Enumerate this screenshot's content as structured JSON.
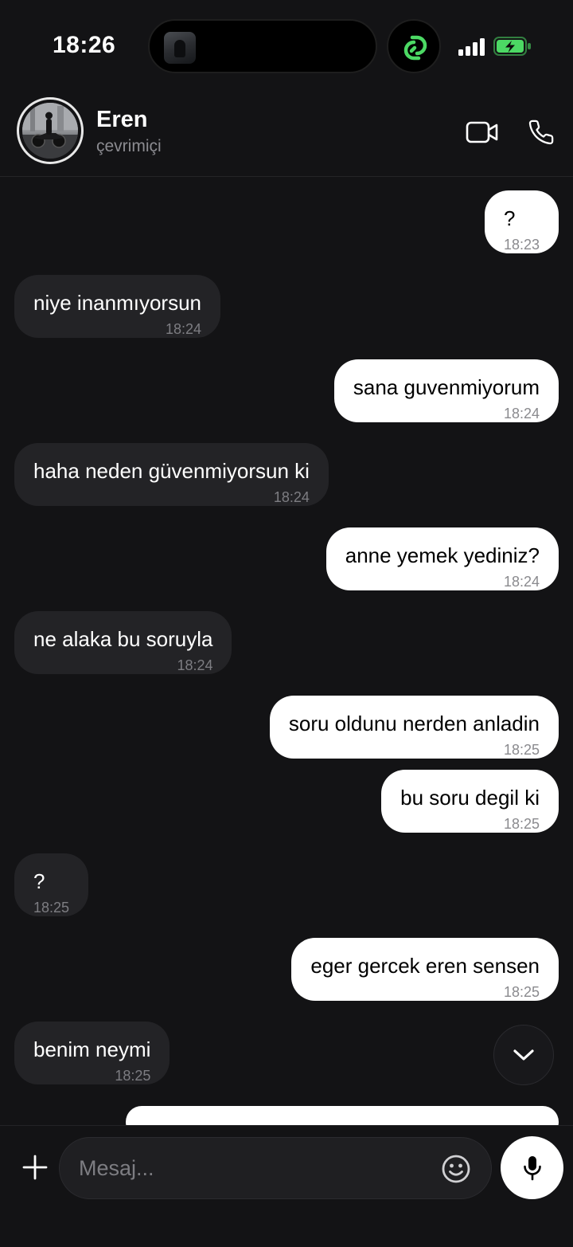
{
  "status_bar": {
    "time": "18:26",
    "icons": [
      "album-art-icon",
      "link-app-icon",
      "signal-icon",
      "battery-charging-icon"
    ],
    "accent_color": "#4cd964"
  },
  "header": {
    "contact_name": "Eren",
    "contact_status": "çevrimiçi",
    "icons": [
      "avatar",
      "video-call-icon",
      "phone-icon"
    ]
  },
  "messages": [
    {
      "direction": "out",
      "text": "?",
      "time": "18:23"
    },
    {
      "direction": "in",
      "text": "niye inanmıyorsun",
      "time": "18:24"
    },
    {
      "direction": "out",
      "text": "sana guvenmiyorum",
      "time": "18:24"
    },
    {
      "direction": "in",
      "text": "haha neden güvenmiyorsun ki",
      "time": "18:24"
    },
    {
      "direction": "out",
      "text": "anne yemek yediniz?",
      "time": "18:24"
    },
    {
      "direction": "in",
      "text": "ne alaka bu soruyla",
      "time": "18:24"
    },
    {
      "direction": "out",
      "text": "soru oldunu nerden anladin",
      "time": "18:25"
    },
    {
      "direction": "out",
      "text": "bu soru degil ki",
      "time": "18:25"
    },
    {
      "direction": "in",
      "text": "?",
      "time": "18:25"
    },
    {
      "direction": "out",
      "text": "eger gercek eren sensen",
      "time": "18:25"
    },
    {
      "direction": "in",
      "text": "benim neymi",
      "time": "18:25"
    }
  ],
  "composer": {
    "placeholder": "Mesaj...",
    "icons": [
      "plus-icon",
      "emoji-icon",
      "microphone-icon"
    ]
  },
  "colors": {
    "background": "#131315",
    "incoming_bubble": "#232326",
    "outgoing_bubble": "#ffffff",
    "secondary_text": "#8b8b90"
  }
}
